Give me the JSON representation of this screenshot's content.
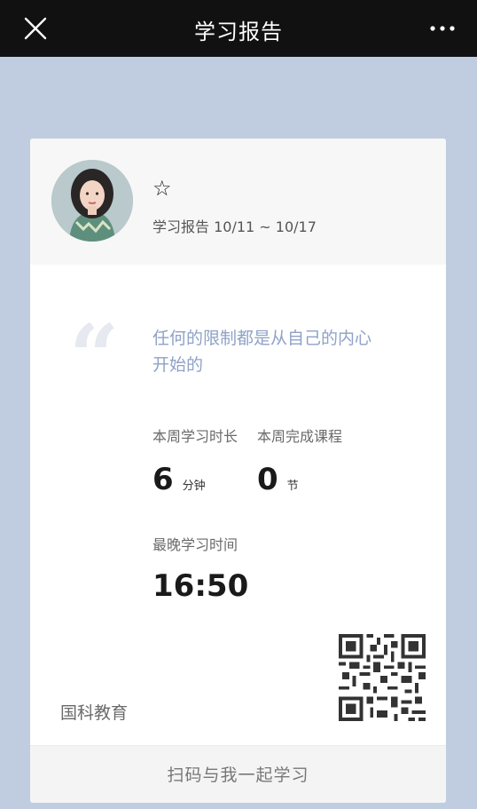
{
  "header": {
    "title": "学习报告",
    "close_icon": "close-icon",
    "more_icon": "more-icon"
  },
  "profile": {
    "avatar": "avatar-photo",
    "name_symbol": "☆",
    "report_range": "学习报告 10/11 ~ 10/17"
  },
  "quote": {
    "mark": "“",
    "text_line1": "任何的限制都是从自己的内心",
    "text_line2": "开始的"
  },
  "stats": {
    "weekly_time_label": "本周学习时长",
    "weekly_time_value": "6",
    "weekly_time_unit": "分钟",
    "weekly_courses_label": "本周完成课程",
    "weekly_courses_value": "0",
    "weekly_courses_unit": "节",
    "latest_time_label": "最晚学习时间",
    "latest_time_value": "16:50"
  },
  "brand": "国科教育",
  "footer": {
    "cta": "扫码与我一起学习"
  },
  "colors": {
    "background": "#c0cde0",
    "topbar": "#111111",
    "quote_text": "#8fa2c6"
  }
}
